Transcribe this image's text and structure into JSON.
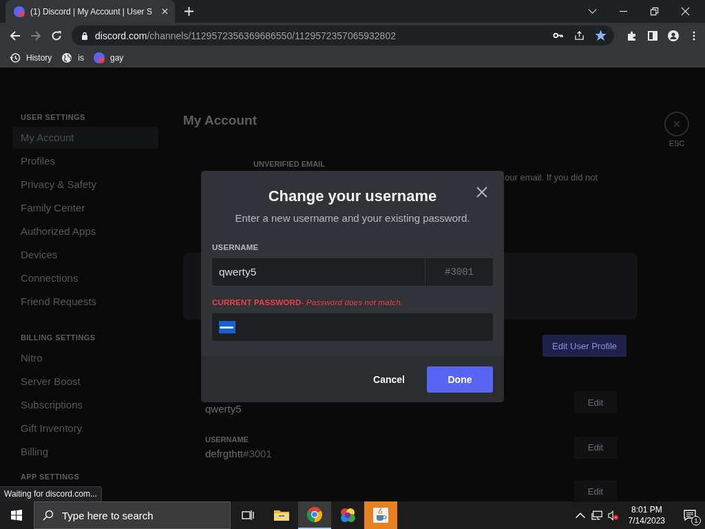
{
  "browser": {
    "tabs": [
      {
        "title": "(1) Discord | My Account | User S",
        "selected": true
      }
    ],
    "url_host": "discord.com",
    "url_path": "/channels/1129572356369686550/1129572357065932802",
    "forward_disabled": true,
    "bookmarked": true,
    "bookmarks": [
      {
        "label": "History",
        "kind": "history"
      },
      {
        "label": "is",
        "kind": "globe"
      },
      {
        "label": "gay",
        "kind": "discord"
      }
    ]
  },
  "settings_sidebar": {
    "sections": [
      {
        "heading": "USER SETTINGS",
        "items": [
          {
            "label": "My Account",
            "selected": true
          },
          {
            "label": "Profiles",
            "selected": false
          },
          {
            "label": "Privacy & Safety",
            "selected": false
          },
          {
            "label": "Family Center",
            "selected": false
          },
          {
            "label": "Authorized Apps",
            "selected": false
          },
          {
            "label": "Devices",
            "selected": false
          },
          {
            "label": "Connections",
            "selected": false
          },
          {
            "label": "Friend Requests",
            "selected": false
          }
        ]
      },
      {
        "heading": "BILLING SETTINGS",
        "items": [
          {
            "label": "Nitro",
            "selected": false
          },
          {
            "label": "Server Boost",
            "selected": false
          },
          {
            "label": "Subscriptions",
            "selected": false
          },
          {
            "label": "Gift Inventory",
            "selected": false
          },
          {
            "label": "Billing",
            "selected": false
          }
        ]
      },
      {
        "heading": "APP SETTINGS"
      }
    ]
  },
  "content": {
    "title": "My Account",
    "close_hint": "ESC",
    "email_label": "UNVERIFIED EMAIL",
    "email_text": "our email. If you did not",
    "edit_profile_button": "Edit User Profile",
    "fields": [
      {
        "value": "qwerty5",
        "button": "Edit"
      },
      {
        "label": "USERNAME",
        "value": "defrgthtt",
        "tag": "#3001",
        "button": "Edit"
      },
      {
        "button": "Edit"
      }
    ]
  },
  "dialog": {
    "title": "Change your username",
    "subtitle": "Enter a new username and your existing password.",
    "username_label": "USERNAME",
    "username_value": "qwerty5",
    "discriminator": "#3001",
    "password_label": "CURRENT PASSWORD",
    "password_separator": "-",
    "password_error": "Password does not match.",
    "password_value": "••••••••••",
    "password_value_selected": true,
    "cancel_button": "Cancel",
    "done_button": "Done"
  },
  "status_text": "Waiting for discord.com...",
  "taskbar": {
    "search_placeholder": "Type here to search",
    "apps": [
      {
        "kind": "explorer",
        "open": false,
        "attention": false
      },
      {
        "kind": "chrome",
        "open": true,
        "attention": false
      },
      {
        "kind": "colors",
        "open": false,
        "attention": false
      },
      {
        "kind": "java",
        "open": false,
        "attention": true
      }
    ],
    "volume_muted": true,
    "time": "8:01 PM",
    "date": "7/14/2023",
    "notification_count": "1"
  }
}
